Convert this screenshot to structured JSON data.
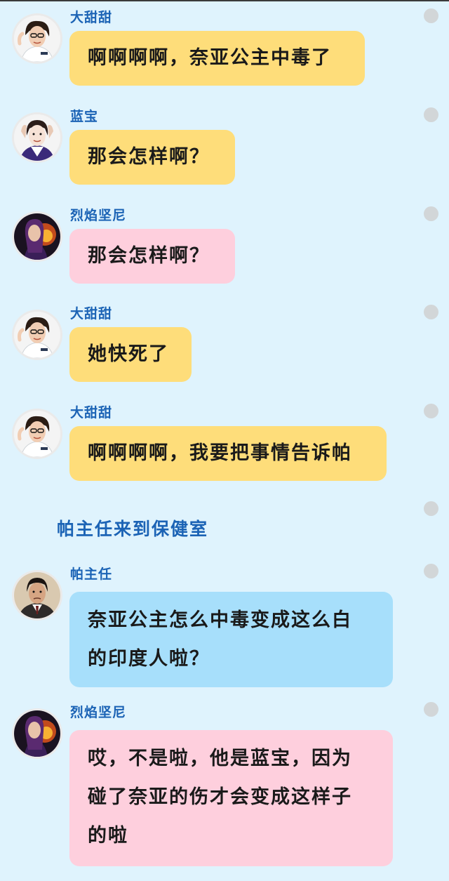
{
  "messages": [
    {
      "speaker": "大甜甜",
      "avatar": "nurse-avatar",
      "color": "yellow",
      "text": "啊啊啊啊，奈亚公主中毒了"
    },
    {
      "speaker": "蓝宝",
      "avatar": "purple-uniform-avatar",
      "color": "yellow",
      "text": "那会怎样啊？"
    },
    {
      "speaker": "烈焰坚尼",
      "avatar": "fire-warrior-avatar",
      "color": "pink",
      "text": "那会怎样啊？"
    },
    {
      "speaker": "大甜甜",
      "avatar": "nurse-avatar",
      "color": "yellow",
      "text": "她快死了"
    },
    {
      "speaker": "大甜甜",
      "avatar": "nurse-avatar",
      "color": "yellow",
      "text": "啊啊啊啊，我要把事情告诉帕"
    },
    {
      "speaker": "帕主任",
      "avatar": "director-avatar",
      "color": "blue",
      "lines": [
        "奈亚公主怎么中毒变成这么白",
        "的印度人啦？"
      ]
    },
    {
      "speaker": "烈焰坚尼",
      "avatar": "fire-warrior-avatar",
      "color": "pink",
      "lines": [
        "哎，不是啦，他是蓝宝，因为",
        "碰了奈亚的伤才会变成这样子",
        "的啦"
      ]
    }
  ],
  "narration": "帕主任来到保健室",
  "colors": {
    "background": "#dff3fd",
    "name": "#1b63b5",
    "yellow_bubble": "#fedd7a",
    "pink_bubble": "#fecfdd",
    "blue_bubble": "#a7dffb",
    "side_dot": "#d2d6d8"
  }
}
